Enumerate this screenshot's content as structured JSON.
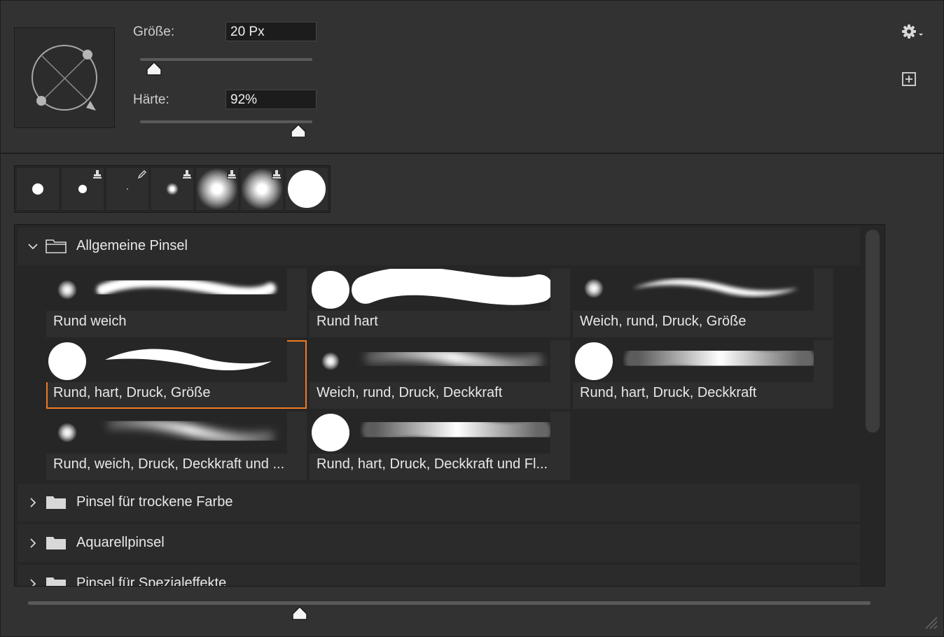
{
  "brush_settings": {
    "size_label": "Größe:",
    "size_value": "20 Px",
    "hardness_label": "Härte:",
    "hardness_value": "92%"
  },
  "icons": {
    "settings": "gear-icon",
    "new_preset": "new-preset-icon",
    "expand": "chevron-down-icon",
    "collapse": "chevron-right-icon",
    "folder": "folder-icon"
  },
  "groups": [
    {
      "title": "Allgemeine Pinsel",
      "expanded": true,
      "brushes": [
        {
          "name": "Rund weich"
        },
        {
          "name": "Rund hart"
        },
        {
          "name": "Weich, rund, Druck, Größe"
        },
        {
          "name": "Rund, hart, Druck, Größe",
          "selected": true
        },
        {
          "name": "Weich, rund, Druck, Deckkraft"
        },
        {
          "name": "Rund, hart, Druck, Deckkraft"
        },
        {
          "name": "Rund, weich, Druck, Deckkraft und ..."
        },
        {
          "name": "Rund, hart, Druck, Deckkraft und Fl..."
        }
      ]
    },
    {
      "title": "Pinsel für trockene Farbe",
      "expanded": false
    },
    {
      "title": "Aquarellpinsel",
      "expanded": false
    },
    {
      "title": "Pinsel für Spezialeffekte",
      "expanded": false
    }
  ],
  "colors": {
    "panel_bg": "#323232",
    "selection": "#f07a22"
  }
}
